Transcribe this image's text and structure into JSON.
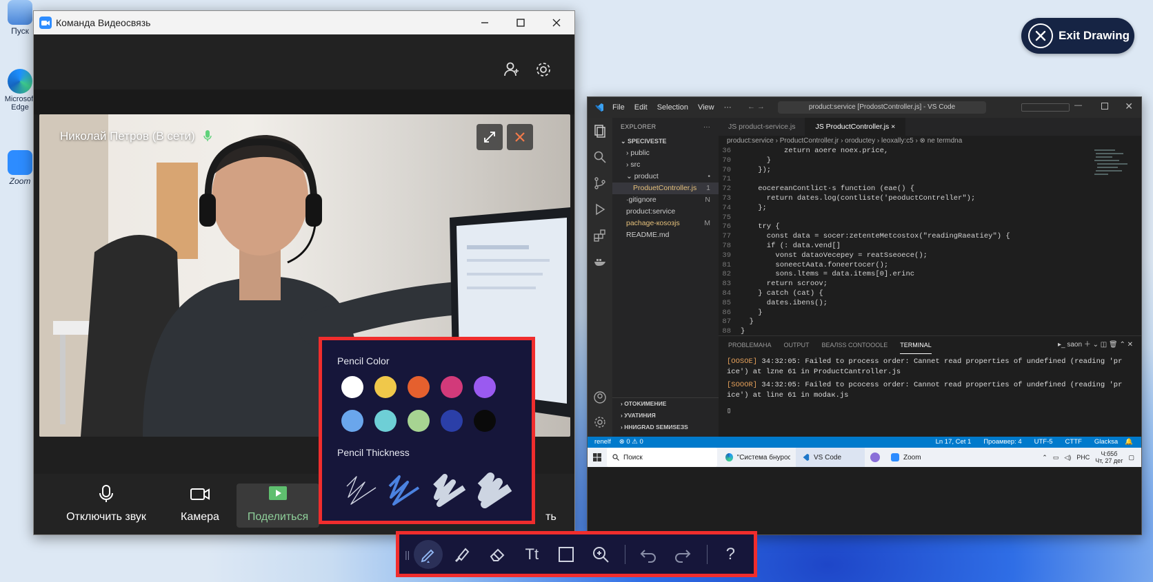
{
  "desktop": {
    "icons": [
      {
        "label": "Пуск"
      },
      {
        "label": "Microsoft Edge"
      },
      {
        "label": "Zoom"
      }
    ]
  },
  "exit_drawing": {
    "label": "Exit Drawing"
  },
  "call_window": {
    "title": "Команда Видеосвязь",
    "participant": "Николай Петров (В сети)",
    "controls": [
      {
        "label": "Отключить звук"
      },
      {
        "label": "Камера"
      },
      {
        "label": "Поделиться"
      },
      {
        "label": "ть"
      }
    ]
  },
  "vscode": {
    "menu": [
      "File",
      "Edit",
      "Selection",
      "View",
      "···"
    ],
    "search": "product:service [ProdostController.js] - VS Code",
    "explorer_header": "EXPLORER",
    "explorer_root": "SPECIVESTE",
    "explorer_items": [
      {
        "label": "› public",
        "badge": ""
      },
      {
        "label": "› src",
        "badge": ""
      },
      {
        "label": "⌄ product",
        "badge": "•"
      },
      {
        "label": "ProduetController.js",
        "badge": "1"
      },
      {
        "label": "·gitignore",
        "badge": "N"
      },
      {
        "label": "product:service",
        "badge": ""
      },
      {
        "label": "pachage-кosoзjs",
        "badge": "M"
      },
      {
        "label": "README.md",
        "badge": ""
      }
    ],
    "explorer_bottom": [
      "› OTOKИМЕНИE",
      "› УVATИНИЯ",
      "› HHИGRAD SEMИSEЗS"
    ],
    "tabs": [
      {
        "label": "JS product-service.js"
      },
      {
        "label": "JS ProductController.js ×"
      }
    ],
    "breadcrumb": "product:service › ProductController.jr › oroductey › leoxally:c5 › ⊗ ne termdna",
    "code_lines": [
      {
        "n": "36",
        "t": "          zeturn aoere noex.price,"
      },
      {
        "n": "70",
        "t": "      }"
      },
      {
        "n": "70",
        "t": "    });"
      },
      {
        "n": "71",
        "t": ""
      },
      {
        "n": "72",
        "t": "    eocereanContlict·s function (eae() {"
      },
      {
        "n": "73",
        "t": "      return dates.log(contliste('peoductContreller\");"
      },
      {
        "n": "74",
        "t": "    };"
      },
      {
        "n": "75",
        "t": ""
      },
      {
        "n": "76",
        "t": "    try {"
      },
      {
        "n": "77",
        "t": "      const data = socer:zetenteMetcostox(\"readingRaeatiey\") {"
      },
      {
        "n": "78",
        "t": "      if (: data.vend[]"
      },
      {
        "n": "39",
        "t": "        vonst dataoVecepey = reatSseoece();"
      },
      {
        "n": "81",
        "t": "        soneectAata.foneertocer();"
      },
      {
        "n": "82",
        "t": "        sons.ltems = data.items[0].erinc"
      },
      {
        "n": "83",
        "t": "      return scroov;"
      },
      {
        "n": "84",
        "t": "    } catch (cat) {"
      },
      {
        "n": "85",
        "t": "      dates.ibens();"
      },
      {
        "n": "86",
        "t": "    }"
      },
      {
        "n": "87",
        "t": "  }"
      },
      {
        "n": "88",
        "t": "}"
      },
      {
        "n": "89",
        "t": ""
      }
    ],
    "panel_tabs": [
      "PROBLEMAHA",
      "OUTPUT",
      "BEAЛSS CONTOOOLE",
      "TERMINAL"
    ],
    "terminal_lines": [
      {
        "tag": "[OOSOE]",
        "t": " 34:32:05: Failed to process order: Cannet read properties of undefined (reading 'pr"
      },
      {
        "tag": "",
        "t": "ice') at lzne 61 in ProductCantroller.js"
      },
      {
        "tag": "[SOOOR]",
        "t": " 34:32:05: Failed to pcocess order: Cannot read properties of undefined (reading 'pr"
      },
      {
        "tag": "",
        "t": "ice') at line 61 in modaк.js"
      }
    ],
    "terminal_label": "saon",
    "status_left": [
      "renelf",
      "⊗ 0 ⚠ 0"
    ],
    "status_right": [
      "Ln 17, Cet 1",
      "Проамвер: 4",
      "UTF-5",
      "CTTF",
      "Glacksa"
    ],
    "taskbar": {
      "search": "Поиск",
      "items": [
        "\"Система бнурос...",
        "VS Code",
        "Zoom"
      ],
      "lang": "РНС",
      "time": "Ч:б5б",
      "date": "Чт, 27 дег"
    }
  },
  "pencil_popup": {
    "color_label": "Pencil Color",
    "thickness_label": "Pencil Thickness",
    "colors": [
      "#ffffff",
      "#f0c84a",
      "#e5602e",
      "#d23a7a",
      "#9a5af0",
      "#6aa6ec",
      "#6ecfd6",
      "#a7d492",
      "#2b3fa8",
      "#0a0a0a"
    ],
    "selected_thickness": 2
  },
  "toolbar": {
    "tools": [
      "pencil-icon",
      "highlighter-icon",
      "eraser-icon",
      "text-icon",
      "rectangle-icon",
      "zoom-in-icon",
      "undo-icon",
      "redo-icon",
      "help-icon"
    ],
    "text_tool_label": "Tt",
    "help_label": "?",
    "active_tool": "pencil-icon"
  },
  "colors": {
    "accent": "#f02d2d",
    "panel": "#16163a",
    "vscode_status": "#007acc"
  }
}
